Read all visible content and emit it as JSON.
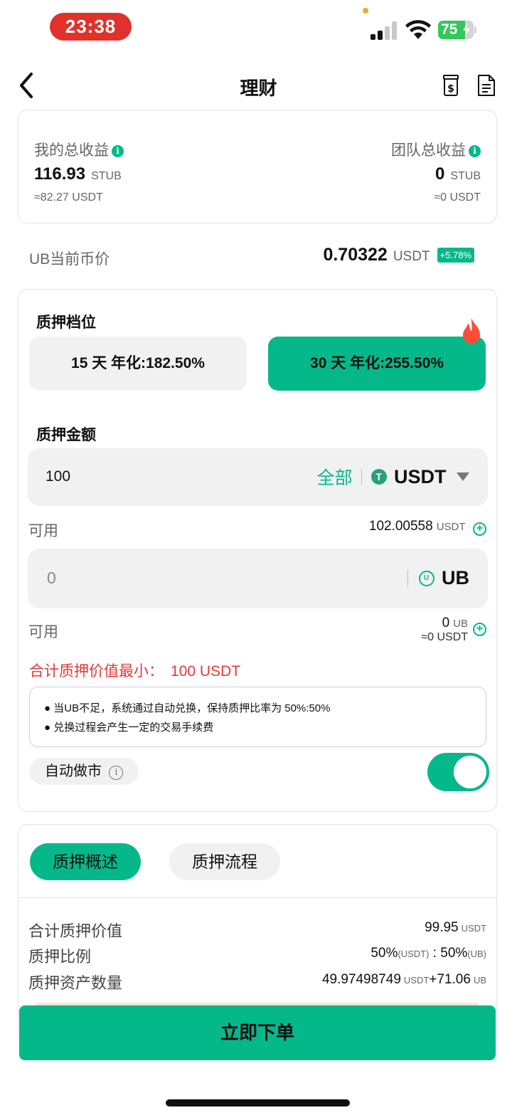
{
  "status_bar": {
    "time": "23:38",
    "battery": "75",
    "battery_level": 0.75
  },
  "nav": {
    "title": "理财",
    "back_icon": "chevron-left-icon",
    "icons": [
      "money-jar-icon",
      "document-icon"
    ]
  },
  "earnings": {
    "mine": {
      "label": "我的总收益",
      "value": "116.93",
      "unit": "STUB",
      "approx": "≈82.27 USDT"
    },
    "team": {
      "label": "团队总收益",
      "value": "0",
      "unit": "STUB",
      "approx": "≈0 USDT"
    }
  },
  "price": {
    "label": "UB当前币价",
    "value": "0.70322",
    "unit": "USDT",
    "change": "+5.78%"
  },
  "stake": {
    "tier_label": "质押档位",
    "tiers": [
      {
        "label": "15 天 年化:182.50%",
        "selected": false
      },
      {
        "label": "30 天 年化:255.50%",
        "selected": true,
        "badge": "fire-icon"
      }
    ],
    "amount_label": "质押金额",
    "usdt_input": {
      "value": "100",
      "all_label": "全部",
      "currency": "USDT"
    },
    "available_label": "可用",
    "usdt_available": {
      "value": "102.00558",
      "unit": "USDT"
    },
    "ub_input": {
      "placeholder": "0",
      "currency": "UB"
    },
    "ub_available": {
      "value": "0",
      "unit": "UB",
      "approx": "≈0 USDT"
    },
    "min_notice": {
      "label": "合计质押价值最小：",
      "value": "100 USDT"
    },
    "notes": [
      "当UB不足，系统通过自动兑换，保持质押比率为 50%:50%",
      "兑换过程会产生一定的交易手续费"
    ],
    "auto_market": {
      "label": "自动做市",
      "enabled": true
    }
  },
  "summary": {
    "tabs": [
      {
        "label": "质押概述",
        "active": true
      },
      {
        "label": "质押流程",
        "active": false
      }
    ],
    "rows": {
      "total": {
        "label": "合计质押价值",
        "value": "99.95",
        "unit": "USDT"
      },
      "ratio": {
        "label": "质押比例",
        "left": "50%",
        "left_unit": "(USDT)",
        "sep": " : ",
        "right": "50%",
        "right_unit": "(UB)"
      },
      "assets": {
        "label": "质押资产数量",
        "usdt": "49.97498749",
        "usdt_unit": "USDT",
        "ub": "+71.06",
        "ub_unit": "UB"
      }
    }
  },
  "order_button": "立即下单",
  "colors": {
    "accent": "#05b88a",
    "danger": "#e53935",
    "badge_bg": "#05b88a"
  }
}
